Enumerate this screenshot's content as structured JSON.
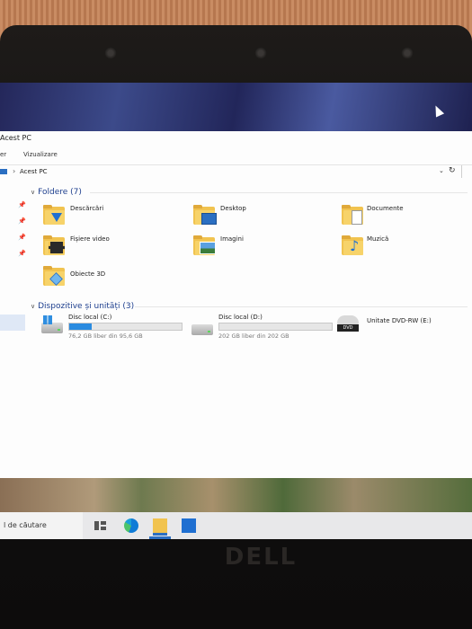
{
  "window": {
    "title": "Acest PC"
  },
  "ribbon": {
    "tabs": [
      "er",
      "Vizualizare"
    ]
  },
  "address": {
    "path": "Acest PC",
    "separator": "›",
    "dropdown": "⌄",
    "refresh": "↻"
  },
  "folders": {
    "header": "Foldere (7)",
    "items": [
      {
        "label": "Descărcări",
        "badge": "download-arrow-icon"
      },
      {
        "label": "Desktop",
        "badge": "desktop-icon"
      },
      {
        "label": "Documente",
        "badge": "document-icon"
      },
      {
        "label": "Fișiere video",
        "badge": "film-icon"
      },
      {
        "label": "Imagini",
        "badge": "picture-icon"
      },
      {
        "label": "Muzică",
        "badge": "music-note-icon"
      },
      {
        "label": "Obiecte 3D",
        "badge": "cube-icon"
      }
    ]
  },
  "devices": {
    "header": "Dispozitive și unități (3)",
    "items": [
      {
        "label": "Disc local (C:)",
        "detail": "76,2 GB liber din 95,6 GB",
        "used_fraction": 0.2
      },
      {
        "label": "Disc local (D:)",
        "detail": "202 GB liber din 202 GB",
        "used_fraction": 0.0
      },
      {
        "label": "Unitate DVD-RW (E:)",
        "detail": "",
        "badge_text": "DVD"
      }
    ]
  },
  "taskbar": {
    "search_placeholder": "l de căutare"
  },
  "hardware": {
    "brand": "DELL"
  },
  "colors": {
    "accent": "#2a8be0",
    "group_header": "#1e3f8e",
    "folder": "#f1c34f"
  }
}
